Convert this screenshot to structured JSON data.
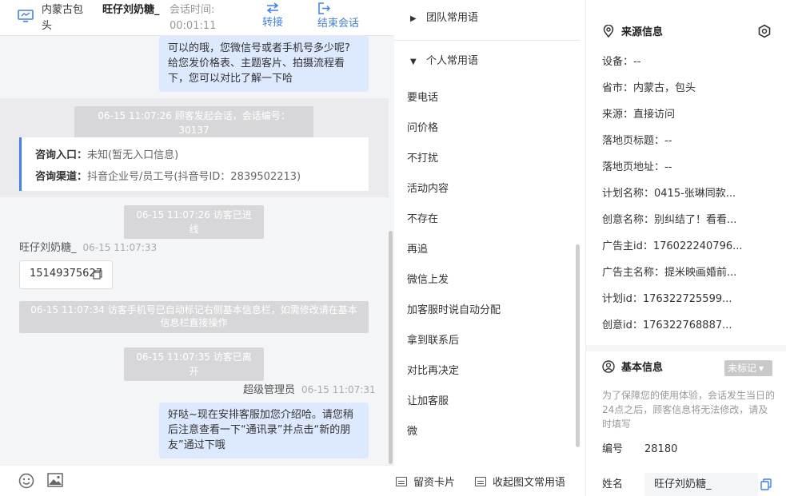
{
  "header": {
    "region": "内蒙古包头",
    "visitor_name": "旺仔刘奶糖_",
    "session_time_label": "会话时间:",
    "session_time_value": "00:01:11",
    "transfer_label": "转接",
    "end_session_label": "结束会话"
  },
  "chat": {
    "messages": [
      {
        "type": "agent_text",
        "text": "可以的哦，您微信号或者手机号多少呢?给您发价格表、主题客片、拍摄流程看下，您可以对比了解一下哈"
      },
      {
        "type": "system",
        "text": "06-15 11:07:26 顾客发起会话，会话编号：30137"
      },
      {
        "type": "entry_card",
        "entry_label": "咨询入口：",
        "entry_value": "未知(暂无入口信息)",
        "channel_label": "咨询渠道：",
        "channel_value": "抖音企业号/员工号(抖音号ID：2839502213)"
      },
      {
        "type": "system",
        "text": "06-15 11:07:26 访客已进线"
      },
      {
        "type": "visitor_meta",
        "sender": "旺仔刘奶糖_",
        "time": "06-15 11:07:33"
      },
      {
        "type": "visitor_text",
        "text": "15149375627"
      },
      {
        "type": "system",
        "text": "06-15 11:07:34 访客手机号已自动标记右侧基本信息栏，如需修改请在基本信息栏直接操作"
      },
      {
        "type": "system",
        "text": "06-15 11:07:35 访客已离开"
      },
      {
        "type": "agent_meta",
        "sender": "超级管理员",
        "time": "06-15 11:07:31"
      },
      {
        "type": "agent_text",
        "text": "好哒~现在安排客服加您介绍哈。请您稍后注意查看一下“通讯录”并点击“新的朋友”通过下哦"
      }
    ]
  },
  "phrases": {
    "team_group": "团队常用语",
    "personal_group": "个人常用语",
    "items": [
      "要电话",
      "问价格",
      "不打扰",
      "活动内容",
      "不存在",
      "再追",
      "微信上发",
      "加客服时说自动分配",
      "拿到联系后",
      "对比再决定",
      "让加客服",
      "微"
    ],
    "footer": {
      "leave_card": "留资卡片",
      "collapse": "收起图文常用语"
    }
  },
  "info": {
    "source_title": "来源信息",
    "source_rows": [
      "设备：--",
      "省市：内蒙古，包头",
      "来源：直接访问",
      "落地页标题：--",
      "落地页地址：--",
      "计划名称：0415-张琳同款...",
      "创意名称：别纠结了！看看...",
      "广告主id：176022240796...",
      "广告主名称：提米映画婚前...",
      "计划id：176322725599...",
      "创意id：176322768887..."
    ],
    "basic_title": "基本信息",
    "tag_label": "未标记",
    "notice": "为了保障您的使用体验，会话发生当日的24点之后，顾客信息将无法修改，请及时填写",
    "id_label": "编号",
    "id_value": "28180",
    "name_label": "姓名",
    "name_value": "旺仔刘奶糖_"
  },
  "colors": {
    "accent": "#3d7fff",
    "agent_bubble": "#dde9ff",
    "system_pill": "#d7d7d9"
  }
}
